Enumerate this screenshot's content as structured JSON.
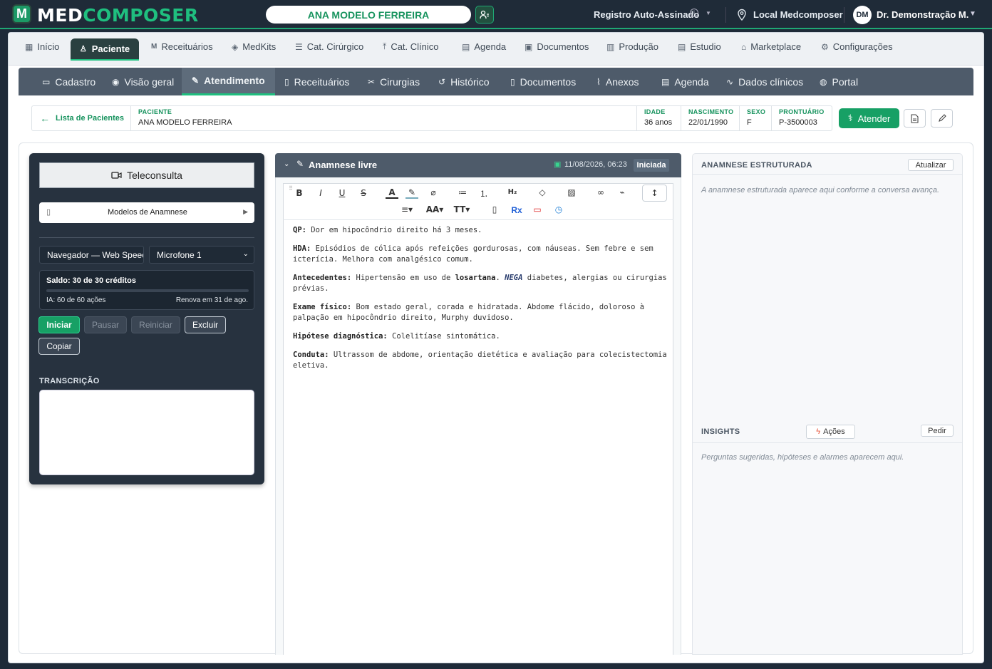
{
  "app": {
    "logo_letter": "M",
    "brand_a": "MED",
    "brand_b": "COMPOSER"
  },
  "header": {
    "patient_name": "ANA MODELO FERREIRA",
    "registry": "Registro Auto-Assinado",
    "location": "Local Medcomposer",
    "user_initials": "DM",
    "user_name": "Dr. Demonstração M."
  },
  "main_nav": [
    {
      "label": "Início",
      "icon": "grid-icon"
    },
    {
      "label": "Paciente",
      "icon": "user-icon",
      "active": true
    },
    {
      "label": "Receituários",
      "icon": "m-icon"
    },
    {
      "label": "MedKits",
      "icon": "layers-icon"
    },
    {
      "label": "Cat. Cirúrgico",
      "icon": "list-icon"
    },
    {
      "label": "Cat. Clínico",
      "icon": "upload-icon"
    },
    {
      "label": "Agenda",
      "icon": "calendar-icon"
    },
    {
      "label": "Documentos",
      "icon": "document-icon"
    },
    {
      "label": "Produção",
      "icon": "bar-chart-icon"
    },
    {
      "label": "Estudio",
      "icon": "file-icon"
    },
    {
      "label": "Marketplace",
      "icon": "store-icon"
    },
    {
      "label": "Configurações",
      "icon": "gear-icon"
    }
  ],
  "sub_nav": [
    {
      "label": "Cadastro"
    },
    {
      "label": "Visão geral"
    },
    {
      "label": "Atendimento",
      "active": true
    },
    {
      "label": "Receituários"
    },
    {
      "label": "Cirurgias"
    },
    {
      "label": "Histórico"
    },
    {
      "label": "Documentos"
    },
    {
      "label": "Anexos"
    },
    {
      "label": "Agenda"
    },
    {
      "label": "Dados clínicos"
    },
    {
      "label": "Portal"
    }
  ],
  "patient": {
    "back_label": "Lista de Pacientes",
    "name_label": "PACIENTE",
    "name": "ANA MODELO FERREIRA",
    "age_label": "IDADE",
    "age": "36 anos",
    "birth_label": "NASCIMENTO",
    "birth": "22/01/1990",
    "sex_label": "SEXO",
    "sex": "F",
    "record_label": "PRONTUÁRIO",
    "record": "P-3500003",
    "atender_label": "Atender"
  },
  "left_panel": {
    "teleconsulta": "Teleconsulta",
    "modelos": "Modelos de Anamnese",
    "engine": "Navegador — Web Speech",
    "mic": "Microfone 1",
    "saldo": "Saldo: 30 de 30 créditos",
    "ia": "IA: 60 de 60 ações",
    "renova": "Renova em 31 de ago.",
    "btn_iniciar": "Iniciar",
    "btn_pausar": "Pausar",
    "btn_reiniciar": "Reiniciar",
    "btn_excluir": "Excluir",
    "btn_copiar": "Copiar",
    "transcricao_label": "TRANSCRIÇÃO"
  },
  "editor": {
    "title": "Anamnese livre",
    "date": "11/08/2026, 06:23",
    "status": "Iniciada",
    "rx_label": "Rx",
    "notes": [
      {
        "label": "QP:",
        "text": " Dor em hipocôndrio direito há 3 meses."
      },
      {
        "label": "HDA:",
        "text": " Episódios de cólica após refeições gordurosas, com náuseas. Sem febre e sem icterícia. Melhora com analgésico comum."
      },
      {
        "label": "Exame físico:",
        "text": " Bom estado geral, corada e hidratada. Abdome flácido, doloroso à palpação em hipocôndrio direito, Murphy duvidoso."
      },
      {
        "label": "Hipótese diagnóstica:",
        "text": " Colelitíase sintomática."
      },
      {
        "label": "Conduta:",
        "text": " Ultrassom de abdome, orientação dietética e avaliação para colecistectomia eletiva."
      }
    ],
    "antecedentes": {
      "label": "Antecedentes:",
      "pre": " Hipertensão em uso de ",
      "drug": "losartana",
      "mid": ". ",
      "nega": "NEGA",
      "post": " diabetes, alergias ou cirurgias prévias."
    }
  },
  "right_panel": {
    "structured_title": "ANAMNESE ESTRUTURADA",
    "atualizar": "Atualizar",
    "structured_placeholder": "A anamnese estruturada aparece aqui conforme a conversa avança.",
    "insights_title": "INSIGHTS",
    "acoes": "Ações",
    "pedir": "Pedir",
    "insights_placeholder": "Perguntas sugeridas, hipóteses e alarmes aparecem aqui."
  },
  "colors": {
    "accent": "#1fbf7f",
    "dark": "#1f2b38",
    "panel": "#4e5b6a"
  }
}
